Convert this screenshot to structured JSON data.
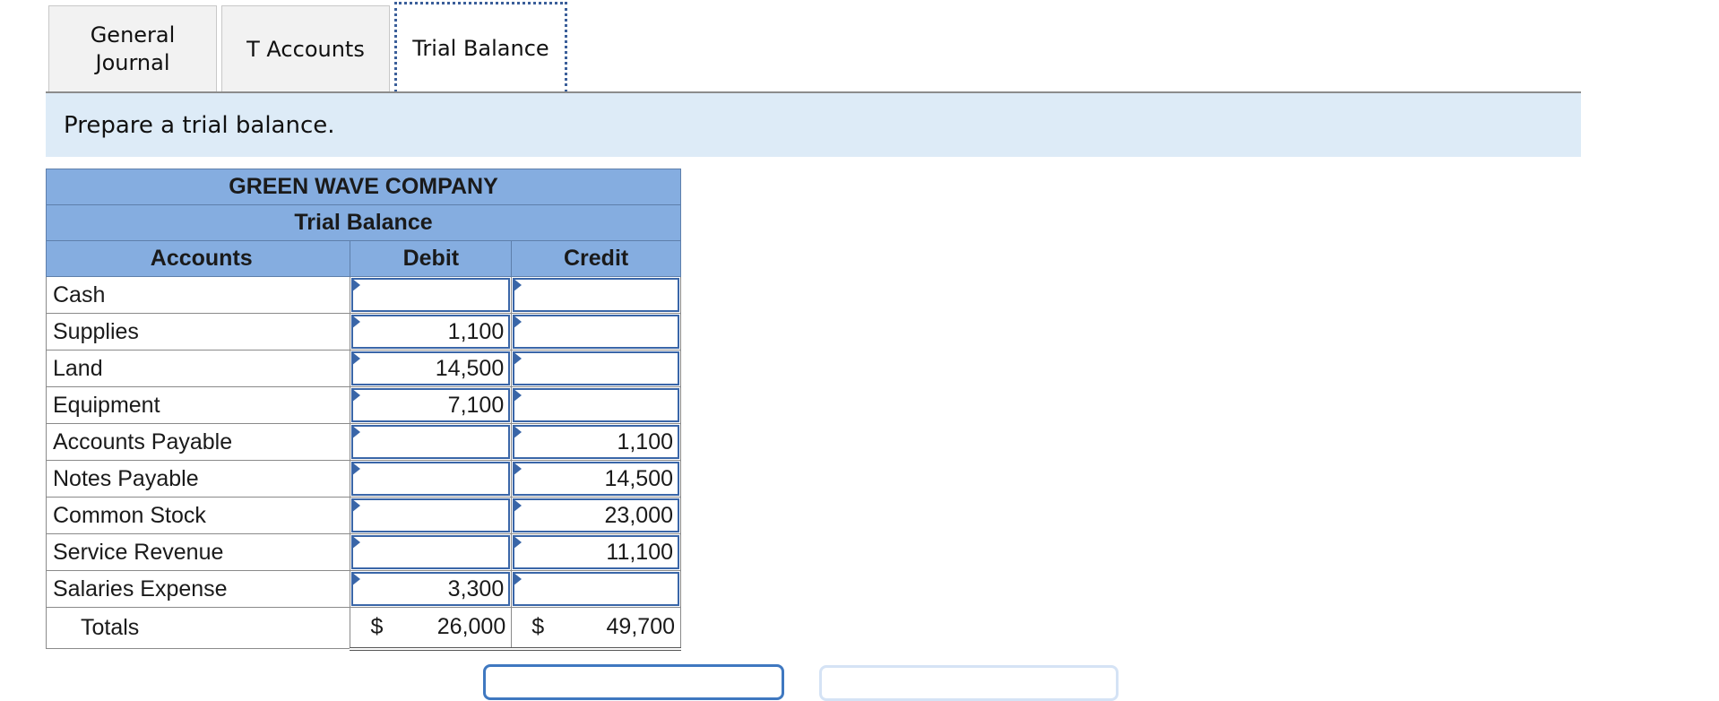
{
  "tabs": [
    {
      "label": "General\nJournal"
    },
    {
      "label": "T Accounts"
    },
    {
      "label": "Trial Balance"
    }
  ],
  "instruction": "Prepare a trial balance.",
  "trial_balance": {
    "company": "GREEN WAVE COMPANY",
    "title": "Trial Balance",
    "columns": {
      "accounts": "Accounts",
      "debit": "Debit",
      "credit": "Credit"
    },
    "rows": [
      {
        "account": "Cash",
        "debit": "",
        "credit": ""
      },
      {
        "account": "Supplies",
        "debit": "1,100",
        "credit": ""
      },
      {
        "account": "Land",
        "debit": "14,500",
        "credit": ""
      },
      {
        "account": "Equipment",
        "debit": "7,100",
        "credit": ""
      },
      {
        "account": "Accounts Payable",
        "debit": "",
        "credit": "1,100"
      },
      {
        "account": "Notes Payable",
        "debit": "",
        "credit": "14,500"
      },
      {
        "account": "Common Stock",
        "debit": "",
        "credit": "23,000"
      },
      {
        "account": "Service Revenue",
        "debit": "",
        "credit": "11,100"
      },
      {
        "account": "Salaries Expense",
        "debit": "3,300",
        "credit": ""
      }
    ],
    "totals": {
      "label": "Totals",
      "debit_symbol": "$",
      "debit": "26,000",
      "credit_symbol": "$",
      "credit": "49,700"
    }
  },
  "colors": {
    "header_blue": "#85ade0",
    "instruction_bg": "#ddebf7",
    "input_border": "#3a66a8"
  }
}
